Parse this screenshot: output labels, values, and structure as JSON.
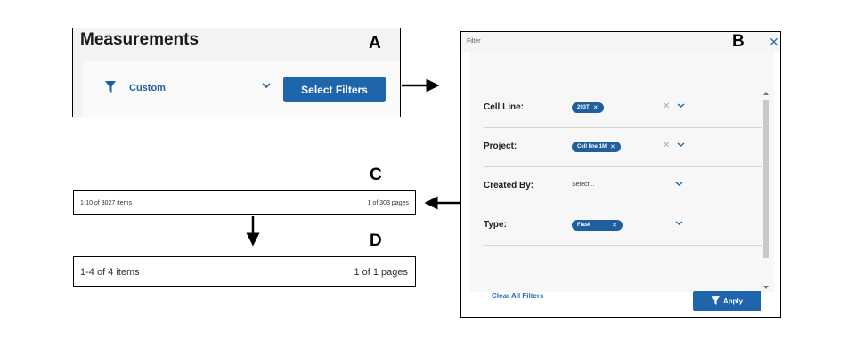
{
  "panel_a": {
    "letter": "A",
    "title": "Measurements",
    "filter_label": "Custom",
    "select_filters_label": "Select Filters"
  },
  "panel_b": {
    "letter": "B",
    "header_title": "Filter",
    "close_glyph": "✕",
    "rows": [
      {
        "label": "Cell Line:",
        "chip": "293T",
        "chip_x": "✕"
      },
      {
        "label": "Project:",
        "chip": "Cell line 1M",
        "chip_x": "✕"
      },
      {
        "label": "Created By:",
        "placeholder": "Select..."
      },
      {
        "label": "Type:",
        "chip": "Flask",
        "chip_x": "✕"
      }
    ],
    "clear_glyph": "✕",
    "clear_all_label": "Clear All Filters",
    "apply_label": "Apply"
  },
  "panel_c": {
    "letter": "C",
    "items_text": "1-10 of 3027 items",
    "pages_text": "1 of 303 pages"
  },
  "panel_d": {
    "letter": "D",
    "items_text": "1-4 of 4 items",
    "pages_text": "1 of 1 pages"
  },
  "colors": {
    "primary": "#1f65ac",
    "link": "#2a6fb5",
    "chip": "#1f5f9d"
  }
}
